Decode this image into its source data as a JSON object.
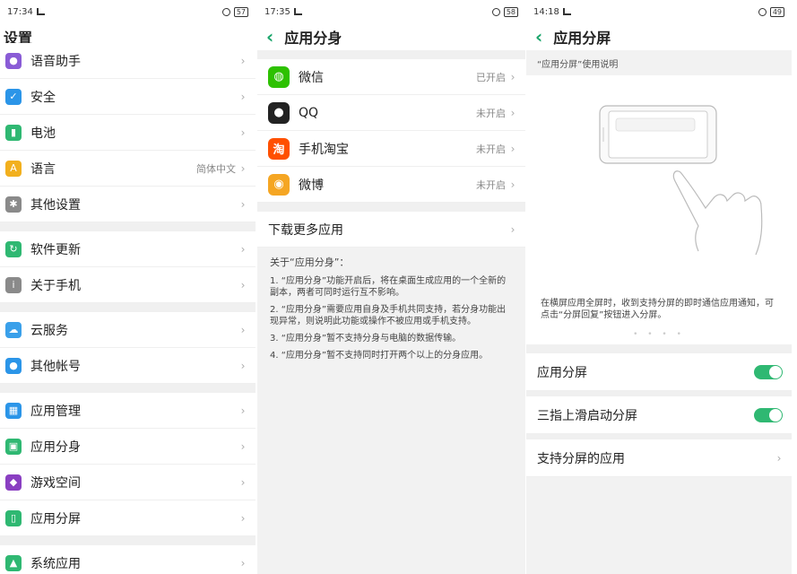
{
  "screen1": {
    "time": "17:34",
    "battery": "57",
    "title": "设置",
    "groups": [
      [
        {
          "label": "语音助手",
          "value": "",
          "icon": "mic-icon",
          "color": "#8a5cd6"
        },
        {
          "label": "安全",
          "value": "",
          "icon": "shield-icon",
          "color": "#2b95e8"
        },
        {
          "label": "电池",
          "value": "",
          "icon": "battery-icon",
          "color": "#2fb872"
        },
        {
          "label": "语言",
          "value": "简体中文",
          "icon": "language-icon",
          "color": "#f2b01e"
        },
        {
          "label": "其他设置",
          "value": "",
          "icon": "gear-icon",
          "color": "#8a8a8a"
        }
      ],
      [
        {
          "label": "软件更新",
          "value": "",
          "icon": "update-icon",
          "color": "#2fb872"
        },
        {
          "label": "关于手机",
          "value": "",
          "icon": "info-icon",
          "color": "#8a8a8a"
        }
      ],
      [
        {
          "label": "云服务",
          "value": "",
          "icon": "cloud-icon",
          "color": "#3aa0ea"
        },
        {
          "label": "其他帐号",
          "value": "",
          "icon": "person-icon",
          "color": "#2b95e8"
        }
      ],
      [
        {
          "label": "应用管理",
          "value": "",
          "icon": "app-grid-icon",
          "color": "#2b95e8"
        },
        {
          "label": "应用分身",
          "value": "",
          "icon": "app-clone-icon",
          "color": "#2fb872"
        },
        {
          "label": "游戏空间",
          "value": "",
          "icon": "game-space-icon",
          "color": "#8a3fc2"
        },
        {
          "label": "应用分屏",
          "value": "",
          "icon": "split-screen-icon",
          "color": "#2fb872"
        }
      ],
      [
        {
          "label": "系统应用",
          "value": "",
          "icon": "android-icon",
          "color": "#2fb872"
        }
      ]
    ]
  },
  "screen2": {
    "time": "17:35",
    "battery": "58",
    "title": "应用分身",
    "apps": [
      {
        "label": "微信",
        "value": "已开启",
        "icon": "wechat-icon",
        "color": "#2dc100"
      },
      {
        "label": "QQ",
        "value": "未开启",
        "icon": "qq-icon",
        "color": "#222222"
      },
      {
        "label": "手机淘宝",
        "value": "未开启",
        "icon": "taobao-icon",
        "color": "#ff5000"
      },
      {
        "label": "微博",
        "value": "未开启",
        "icon": "weibo-icon",
        "color": "#f5a623"
      }
    ],
    "download": "下载更多应用",
    "notes_title": "关于“应用分身”：",
    "notes": [
      "1. “应用分身”功能开启后，将在桌面生成应用的一个全新的副本，两者可同时运行互不影响。",
      "2. “应用分身”需要应用自身及手机共同支持，若分身功能出现异常，则说明此功能或操作不被应用或手机支持。",
      "3. “应用分身”暂不支持分身与电脑的数据传输。",
      "4. “应用分身”暂不支持同时打开两个以上的分身应用。"
    ]
  },
  "screen3": {
    "time": "14:18",
    "battery": "49",
    "title": "应用分屏",
    "subhead": "“应用分屏”使用说明",
    "description": "在横屏应用全屏时，收到支持分屏的即时通信应用通知，可点击“分屏回复”按钮进入分屏。",
    "dots": "• • • •",
    "toggle1": "应用分屏",
    "toggle2": "三指上滑启动分屏",
    "supported": "支持分屏的应用",
    "accent": "#2fb872"
  }
}
